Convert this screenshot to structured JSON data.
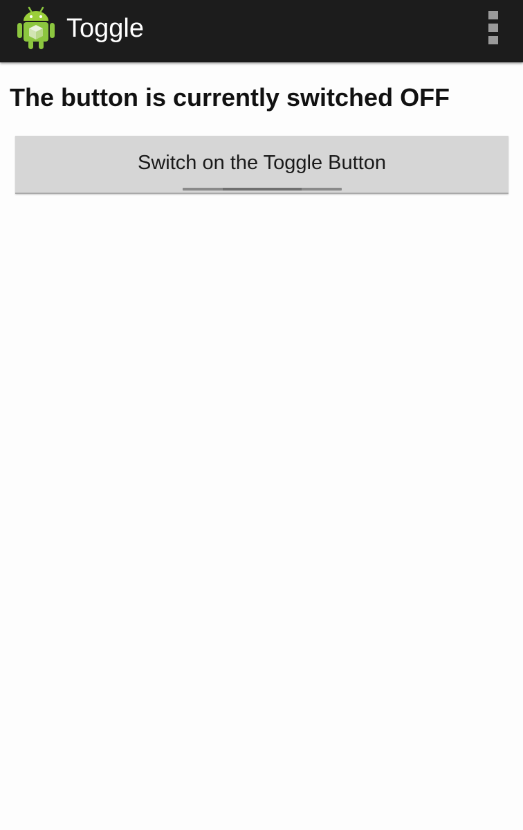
{
  "action_bar": {
    "title": "Toggle",
    "icon": "android-robot-icon",
    "overflow_icon": "overflow-menu-icon",
    "background_color": "#1c1c1c"
  },
  "main": {
    "status_text": "The button is currently switched OFF",
    "toggle_button": {
      "label": "Switch on the Toggle Button",
      "checked": false,
      "indicator_color": "#6f6f6f",
      "background_color": "#d6d6d6"
    }
  }
}
